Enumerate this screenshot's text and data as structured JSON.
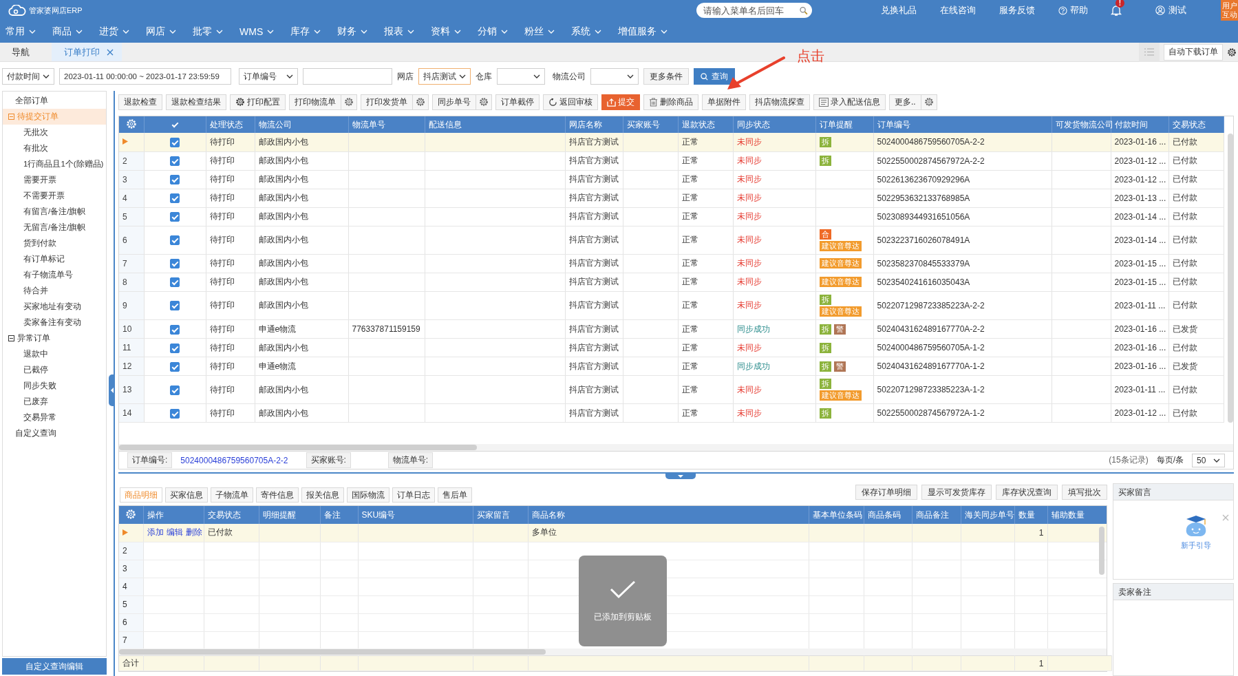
{
  "header": {
    "app_title": "管家婆网店ERP",
    "search_placeholder": "请输入菜单名后回车",
    "links": [
      "兑换礼品",
      "在线咨询",
      "服务反馈"
    ],
    "help": "帮助",
    "bell_badge": "!",
    "user": "测试",
    "corner_badge": "用户互动"
  },
  "menu": [
    "常用",
    "商品",
    "进货",
    "网店",
    "批零",
    "WMS",
    "库存",
    "财务",
    "报表",
    "资料",
    "分销",
    "粉丝",
    "系统",
    "增值服务"
  ],
  "tabs": [
    {
      "label": "导航",
      "selected": false,
      "closable": false
    },
    {
      "label": "订单打印",
      "selected": true,
      "closable": true
    }
  ],
  "tab_bar_button": "自动下载订单",
  "filters": {
    "time_type": "付款时间",
    "time_range": "2023-01-11 00:00:00 ~ 2023-01-17 23:59:59",
    "order_field": "订单编号",
    "shop_label": "网店",
    "shop": "抖店测试",
    "warehouse_label": "仓库",
    "logistics_label": "物流公司",
    "more": "更多条件",
    "query": "查询"
  },
  "annotation": "点击",
  "sidebar": {
    "items": [
      {
        "label": "全部订单",
        "selected": false
      },
      {
        "label": "待提交订单",
        "selected": true,
        "expanded": true,
        "children": [
          {
            "label": "无批次",
            "selected": false
          },
          {
            "label": "有批次",
            "selected": false
          },
          {
            "label": "1行商品且1个(除赠品)",
            "selected": false
          },
          {
            "label": "需要开票",
            "selected": false
          },
          {
            "label": "不需要开票",
            "selected": false
          },
          {
            "label": "有留言/备注/旗帜",
            "selected": false
          },
          {
            "label": "无留言/备注/旗帜",
            "selected": false
          },
          {
            "label": "货到付款",
            "selected": false
          },
          {
            "label": "有订单标记",
            "selected": false
          },
          {
            "label": "有子物流单号",
            "selected": false
          },
          {
            "label": "待合并",
            "selected": false
          },
          {
            "label": "买家地址有变动",
            "selected": false
          },
          {
            "label": "卖家备注有变动",
            "selected": false
          }
        ]
      },
      {
        "label": "异常订单",
        "selected": false,
        "expanded": true,
        "children": [
          {
            "label": "退款中",
            "selected": false
          },
          {
            "label": "已截停",
            "selected": false
          },
          {
            "label": "同步失败",
            "selected": false
          },
          {
            "label": "已废弃",
            "selected": false
          },
          {
            "label": "交易异常",
            "selected": false
          }
        ]
      },
      {
        "label": "自定义查询",
        "selected": false
      }
    ],
    "button": "自定义查询编辑"
  },
  "toolbar": [
    {
      "label": "退款检查",
      "primary": false,
      "settings": false
    },
    {
      "label": "退款检查结果",
      "primary": false,
      "settings": false
    },
    {
      "label": "打印配置",
      "kind": "gear",
      "primary": false,
      "settings": false
    },
    {
      "label": "打印物流单",
      "primary": false,
      "settings": true
    },
    {
      "label": "打印发货单",
      "primary": false,
      "settings": true
    },
    {
      "label": "同步单号",
      "primary": false,
      "settings": true
    },
    {
      "label": "订单截停",
      "primary": false,
      "settings": false
    },
    {
      "label": "返回审核",
      "kind": "refresh",
      "primary": false,
      "settings": false
    },
    {
      "label": "提交",
      "kind": "upload",
      "primary": true,
      "settings": false
    },
    {
      "label": "删除商品",
      "kind": "trash",
      "primary": false,
      "settings": false
    },
    {
      "label": "单据附件",
      "primary": false,
      "settings": false
    },
    {
      "label": "抖店物流探查",
      "primary": false,
      "settings": false
    },
    {
      "label": "录入配送信息",
      "kind": "doc",
      "primary": false,
      "settings": false
    },
    {
      "label": "更多..",
      "primary": false,
      "settings": true
    }
  ],
  "orders": {
    "all_checked": true,
    "columns": [
      "处理状态",
      "物流公司",
      "物流单号",
      "配送信息",
      "网店名称",
      "买家账号",
      "退款状态",
      "同步状态",
      "订单提醒",
      "订单编号",
      "可发货物流公司",
      "付款时间",
      "交易状态"
    ],
    "rows": [
      {
        "selected": true,
        "checked": true,
        "status": "待打印",
        "carrier": "邮政国内小包",
        "shop": "抖店官方测试",
        "refund": "正常",
        "sync": "未同步",
        "sync_ok": false,
        "tags": [
          {
            "label": "拆",
            "kind": "split"
          }
        ],
        "order_no": "5024000486759560705A-2-2",
        "paid_time": "2023-01-16 ...",
        "trade": "已付款"
      },
      {
        "no": "2",
        "selected": false,
        "checked": true,
        "status": "待打印",
        "carrier": "邮政国内小包",
        "shop": "抖店官方测试",
        "refund": "正常",
        "sync": "未同步",
        "sync_ok": false,
        "tags": [
          {
            "label": "拆",
            "kind": "split"
          }
        ],
        "order_no": "5022550002874567972A-2-2",
        "paid_time": "2023-01-12 ...",
        "trade": "已付款"
      },
      {
        "no": "3",
        "selected": false,
        "checked": true,
        "status": "待打印",
        "carrier": "邮政国内小包",
        "shop": "抖店官方测试",
        "refund": "正常",
        "sync": "未同步",
        "sync_ok": false,
        "order_no": "5022613623670929296A",
        "paid_time": "2023-01-12 ...",
        "trade": "已付款"
      },
      {
        "no": "4",
        "selected": false,
        "checked": true,
        "status": "待打印",
        "carrier": "邮政国内小包",
        "shop": "抖店官方测试",
        "refund": "正常",
        "sync": "未同步",
        "sync_ok": false,
        "order_no": "5022953632133768985A",
        "paid_time": "2023-01-13 ...",
        "trade": "已付款"
      },
      {
        "no": "5",
        "selected": false,
        "checked": true,
        "status": "待打印",
        "carrier": "邮政国内小包",
        "shop": "抖店官方测试",
        "refund": "正常",
        "sync": "未同步",
        "sync_ok": false,
        "order_no": "5023089344931651056A",
        "paid_time": "2023-01-14 ...",
        "trade": "已付款"
      },
      {
        "no": "6",
        "selected": false,
        "checked": true,
        "status": "待打印",
        "carrier": "邮政国内小包",
        "shop": "抖店官方测试",
        "refund": "正常",
        "sync": "未同步",
        "sync_ok": false,
        "tags": [
          {
            "label": "合",
            "kind": "merge"
          },
          {
            "label": "建议音尊达",
            "kind": "suggest"
          }
        ],
        "order_no": "5023223716026078491A",
        "paid_time": "2023-01-14 ...",
        "trade": "已付款"
      },
      {
        "no": "7",
        "selected": false,
        "checked": true,
        "status": "待打印",
        "carrier": "邮政国内小包",
        "shop": "抖店官方测试",
        "refund": "正常",
        "sync": "未同步",
        "sync_ok": false,
        "tags": [
          {
            "label": "建议音尊达",
            "kind": "suggest"
          }
        ],
        "order_no": "5023582370845533379A",
        "paid_time": "2023-01-15 ...",
        "trade": "已付款"
      },
      {
        "no": "8",
        "selected": false,
        "checked": true,
        "status": "待打印",
        "carrier": "邮政国内小包",
        "shop": "抖店官方测试",
        "refund": "正常",
        "sync": "未同步",
        "sync_ok": false,
        "tags": [
          {
            "label": "建议音尊达",
            "kind": "suggest"
          }
        ],
        "order_no": "5023540241616035043A",
        "paid_time": "2023-01-15 ...",
        "trade": "已付款"
      },
      {
        "no": "9",
        "selected": false,
        "checked": true,
        "status": "待打印",
        "carrier": "邮政国内小包",
        "shop": "抖店官方测试",
        "refund": "正常",
        "sync": "未同步",
        "sync_ok": false,
        "tags": [
          {
            "label": "拆",
            "kind": "split"
          },
          {
            "label": "建议音尊达",
            "kind": "suggest"
          }
        ],
        "order_no": "5022071298723385223A-2-2",
        "paid_time": "2023-01-11 ...",
        "trade": "已付款"
      },
      {
        "no": "10",
        "selected": false,
        "checked": true,
        "status": "待打印",
        "carrier": "申通e物流",
        "tracking": "776337871159159",
        "shop": "抖店官方测试",
        "refund": "正常",
        "sync": "同步成功",
        "sync_ok": true,
        "tags": [
          {
            "label": "拆",
            "kind": "split"
          },
          {
            "label": "警",
            "kind": "warn"
          }
        ],
        "order_no": "5024043162489167770A-2-2",
        "paid_time": "2023-01-16 ...",
        "trade": "已发货"
      },
      {
        "no": "11",
        "selected": false,
        "checked": true,
        "status": "待打印",
        "carrier": "邮政国内小包",
        "shop": "抖店官方测试",
        "refund": "正常",
        "sync": "未同步",
        "sync_ok": false,
        "tags": [
          {
            "label": "拆",
            "kind": "split"
          }
        ],
        "order_no": "5024000486759560705A-1-2",
        "paid_time": "2023-01-16 ...",
        "trade": "已付款"
      },
      {
        "no": "12",
        "selected": false,
        "checked": true,
        "status": "待打印",
        "carrier": "申通e物流",
        "shop": "抖店官方测试",
        "refund": "正常",
        "sync": "同步成功",
        "sync_ok": true,
        "tags": [
          {
            "label": "拆",
            "kind": "split"
          },
          {
            "label": "警",
            "kind": "warn"
          }
        ],
        "order_no": "5024043162489167770A-1-2",
        "paid_time": "2023-01-16 ...",
        "trade": "已发货"
      },
      {
        "no": "13",
        "selected": false,
        "checked": true,
        "status": "待打印",
        "carrier": "邮政国内小包",
        "shop": "抖店官方测试",
        "refund": "正常",
        "sync": "未同步",
        "sync_ok": false,
        "tags": [
          {
            "label": "拆",
            "kind": "split"
          },
          {
            "label": "建议音尊达",
            "kind": "suggest"
          }
        ],
        "order_no": "5022071298723385223A-1-2",
        "paid_time": "2023-01-11 ...",
        "trade": "已付款"
      },
      {
        "no": "14",
        "selected": false,
        "checked": true,
        "status": "待打印",
        "carrier": "邮政国内小包",
        "shop": "抖店官方测试",
        "refund": "正常",
        "sync": "未同步",
        "sync_ok": false,
        "tags": [
          {
            "label": "拆",
            "kind": "split"
          }
        ],
        "order_no": "5022550002874567972A-1-2",
        "paid_time": "2023-01-12 ...",
        "trade": "已付款"
      }
    ]
  },
  "info_bar": {
    "fields": [
      {
        "label": "订单编号:",
        "value": "5024000486759560705A-2-2"
      },
      {
        "label": "买家账号:"
      },
      {
        "label": "物流单号:"
      }
    ],
    "records": "(15条记录)",
    "per_page_label": "每页/条",
    "per_page": "50"
  },
  "detail": {
    "tabs": [
      {
        "label": "商品明细",
        "selected": true
      },
      {
        "label": "买家信息",
        "selected": false
      },
      {
        "label": "子物流单",
        "selected": false
      },
      {
        "label": "寄件信息",
        "selected": false
      },
      {
        "label": "报关信息",
        "selected": false
      },
      {
        "label": "国际物流",
        "selected": false
      },
      {
        "label": "订单日志",
        "selected": false
      },
      {
        "label": "售后单",
        "selected": false
      }
    ],
    "buttons": [
      "保存订单明细",
      "显示可发货库存",
      "库存状况查询",
      "填写批次"
    ],
    "columns": [
      "操作",
      "交易状态",
      "明细提醒",
      "备注",
      "SKU编号",
      "买家留言",
      "商品名称",
      "基本单位条码",
      "商品条码",
      "商品备注",
      "海关同步单号",
      "数量",
      "辅助数量"
    ],
    "rows": [
      {
        "selected": true,
        "ops": [
          "添加",
          "编辑",
          "删除"
        ],
        "trade": "已付款",
        "name": "多单位",
        "qty": "1"
      },
      {
        "no": "2",
        "selected": false
      },
      {
        "no": "3",
        "selected": false
      },
      {
        "no": "4",
        "selected": false
      },
      {
        "no": "5",
        "selected": false
      },
      {
        "no": "6",
        "selected": false
      },
      {
        "no": "7",
        "selected": false
      }
    ],
    "total": {
      "label": "合计",
      "qty": "1"
    },
    "toast": "已添加到剪贴板"
  },
  "notes": {
    "panels": [
      "买家留言",
      "卖家备注"
    ],
    "guide": "新手引导"
  }
}
